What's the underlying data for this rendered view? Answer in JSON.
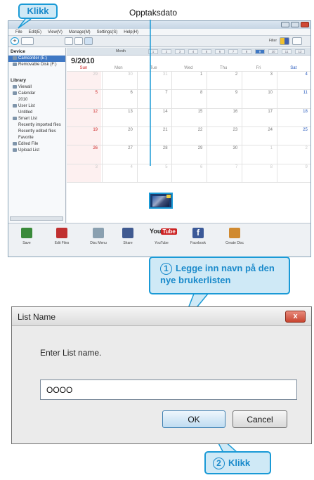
{
  "annotations": {
    "click_label_top": "Klikk",
    "recording_date_label": "Opptaksdato",
    "step1_number": "1",
    "step1_text": "Legge inn navn på den nye brukerlisten",
    "step2_number": "2",
    "step2_text": "Klikk"
  },
  "app": {
    "menu": [
      "File",
      "Edit(E)",
      "View(V)",
      "Manage(M)",
      "Settings(S)",
      "Help(H)"
    ],
    "toolbar": {
      "filter_label": "Filter"
    },
    "sidebar": {
      "device_heading": "Device",
      "devices": [
        "Camcorder (E:)",
        "Removable Disk (F:)"
      ],
      "library_heading": "Library",
      "library_items": [
        "Viewall",
        "Calendar",
        "2010",
        "User List",
        "Untitled",
        "Smart List",
        "Recently imported files",
        "Recently edited files",
        "Favorite",
        "Edited File",
        "Upload List"
      ]
    },
    "calendar": {
      "view_label": "Month",
      "month_cells": [
        "1",
        "2",
        "3",
        "4",
        "5",
        "6",
        "7",
        "8",
        "9",
        "10",
        "11",
        "12"
      ],
      "active_month_index": 8,
      "title": "9/2010",
      "weekdays": [
        "Sun",
        "Mon",
        "Tue",
        "Wed",
        "Thu",
        "Fri",
        "Sat"
      ],
      "weeks": [
        [
          "29",
          "30",
          "31",
          "1",
          "2",
          "3",
          "4"
        ],
        [
          "5",
          "6",
          "7",
          "8",
          "9",
          "10",
          "11"
        ],
        [
          "12",
          "13",
          "14",
          "15",
          "16",
          "17",
          "18"
        ],
        [
          "19",
          "20",
          "21",
          "22",
          "23",
          "24",
          "25"
        ],
        [
          "26",
          "27",
          "28",
          "29",
          "30",
          "1",
          "2"
        ],
        [
          "3",
          "4",
          "5",
          "6",
          "7",
          "8",
          "9"
        ]
      ]
    },
    "bottom": [
      {
        "label": "Save",
        "icon": "save-disc-icon",
        "color": "#3a8a3a"
      },
      {
        "label": "Edit Files",
        "icon": "edit-files-icon",
        "color": "#c03030"
      },
      {
        "label": "Disc Menu",
        "icon": "disc-menu-icon",
        "color": "#8aa0b0"
      },
      {
        "label": "Share",
        "icon": "share-icon",
        "color": "#405a90"
      },
      {
        "label": "YouTube",
        "icon": "youtube-logo",
        "color": "#cc2222"
      },
      {
        "label": "Facebook",
        "icon": "facebook-logo",
        "color": "#3b5998"
      },
      {
        "label": "Create Disc",
        "icon": "create-disc-icon",
        "color": "#d08a30"
      }
    ]
  },
  "dialog": {
    "title": "List Name",
    "close_label": "x",
    "prompt": "Enter List name.",
    "input_value": "OOOO",
    "ok_label": "OK",
    "cancel_label": "Cancel"
  }
}
